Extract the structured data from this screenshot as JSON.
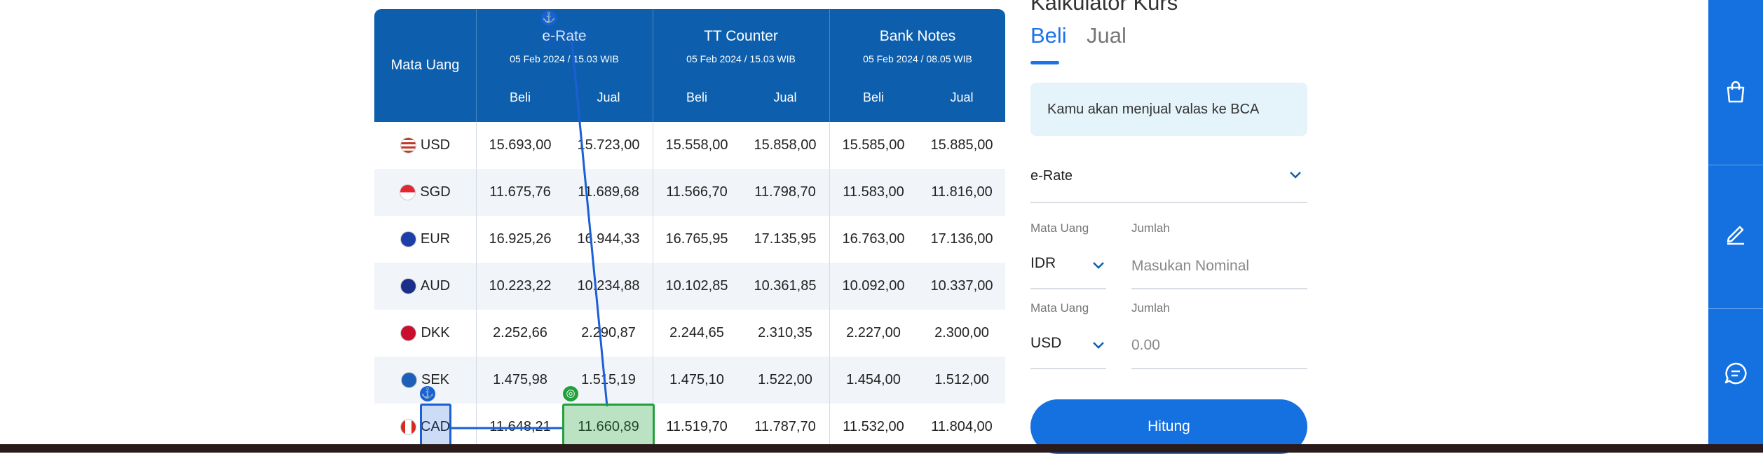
{
  "table": {
    "header": {
      "currency_label": "Mata Uang",
      "groups": [
        {
          "title": "e-Rate",
          "date": "05 Feb 2024 / 15.03 WIB",
          "buy": "Beli",
          "sell": "Jual"
        },
        {
          "title": "TT Counter",
          "date": "05 Feb 2024 / 15.03 WIB",
          "buy": "Beli",
          "sell": "Jual"
        },
        {
          "title": "Bank Notes",
          "date": "05 Feb 2024 / 08.05 WIB",
          "buy": "Beli",
          "sell": "Jual"
        }
      ]
    },
    "rows": [
      {
        "code": "USD",
        "flag": "flag-us-icon",
        "values": [
          "15.693,00",
          "15.723,00",
          "15.558,00",
          "15.858,00",
          "15.585,00",
          "15.885,00"
        ]
      },
      {
        "code": "SGD",
        "flag": "flag-sg-icon",
        "values": [
          "11.675,76",
          "11.689,68",
          "11.566,70",
          "11.798,70",
          "11.583,00",
          "11.816,00"
        ]
      },
      {
        "code": "EUR",
        "flag": "flag-eu-icon",
        "values": [
          "16.925,26",
          "16.944,33",
          "16.765,95",
          "17.135,95",
          "16.763,00",
          "17.136,00"
        ]
      },
      {
        "code": "AUD",
        "flag": "flag-au-icon",
        "values": [
          "10.223,22",
          "10.234,88",
          "10.102,85",
          "10.361,85",
          "10.092,00",
          "10.337,00"
        ]
      },
      {
        "code": "DKK",
        "flag": "flag-dk-icon",
        "values": [
          "2.252,66",
          "2.290,87",
          "2.244,65",
          "2.310,35",
          "2.227,00",
          "2.300,00"
        ]
      },
      {
        "code": "SEK",
        "flag": "flag-se-icon",
        "values": [
          "1.475,98",
          "1.515,19",
          "1.475,10",
          "1.522,00",
          "1.454,00",
          "1.512,00"
        ]
      },
      {
        "code": "CAD",
        "flag": "flag-ca-icon",
        "values": [
          "11.648,21",
          "11.660,89",
          "11.519,70",
          "11.787,70",
          "11.532,00",
          "11.804,00"
        ]
      }
    ]
  },
  "calculator": {
    "title": "Kalkulator Kurs",
    "tabs": {
      "buy": "Beli",
      "sell": "Jual"
    },
    "info": "Kamu akan menjual valas ke BCA",
    "rate_type": "e-Rate",
    "from": {
      "currency_label": "Mata Uang",
      "currency": "IDR",
      "amount_label": "Jumlah",
      "placeholder": "Masukan Nominal",
      "value": ""
    },
    "to": {
      "currency_label": "Mata Uang",
      "currency": "USD",
      "amount_label": "Jumlah",
      "placeholder": "0.00",
      "value": ""
    },
    "button": "Hitung"
  },
  "sidebar": {
    "icons": [
      "shopping-bag-icon",
      "pencil-icon",
      "chat-icon"
    ]
  },
  "colors": {
    "primary": "#0d5fad",
    "accent": "#1570e0",
    "info_bg": "#e5f4fb",
    "overlay_blue": "#1a5fd6",
    "overlay_green": "#22a03a"
  }
}
